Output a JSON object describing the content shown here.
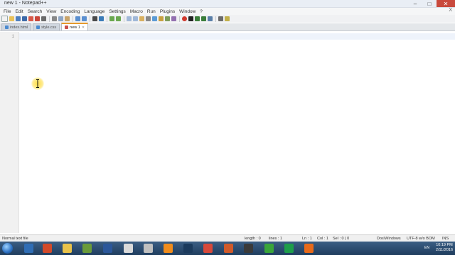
{
  "window": {
    "title": "new 1 - Notepad++",
    "minimize": "–",
    "maximize": "□",
    "close": "✕"
  },
  "menu": [
    "File",
    "Edit",
    "Search",
    "View",
    "Encoding",
    "Language",
    "Settings",
    "Macro",
    "Run",
    "Plugins",
    "Window",
    "?"
  ],
  "menu_close": "X",
  "tabs": [
    {
      "label": "index.html",
      "active": false
    },
    {
      "label": "style.css",
      "active": false
    },
    {
      "label": "new 1",
      "active": true
    }
  ],
  "editor": {
    "line_number": "1"
  },
  "status": {
    "file_type": "Normal text file",
    "length": "length : 0",
    "lines": "lines : 1",
    "ln": "Ln : 1",
    "col": "Col : 1",
    "sel": "Sel : 0 | 0",
    "eol": "Dos\\Windows",
    "encoding": "UTF-8 w/o BOM",
    "mode": "INS"
  },
  "taskbar": {
    "lang": "EN",
    "time": "10:19 PM",
    "date": "2/11/2016"
  },
  "colors": {
    "accent_tab": "#e69a2c",
    "cursor_highlight": "#ffdc3c"
  }
}
